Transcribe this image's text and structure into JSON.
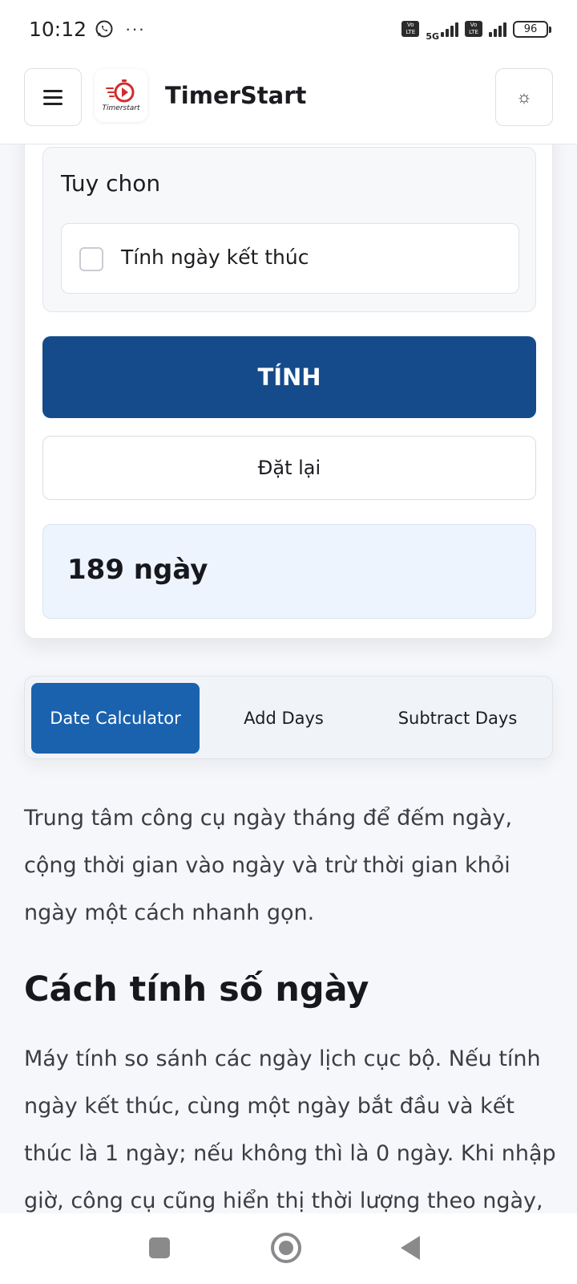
{
  "status_bar": {
    "time": "10:12",
    "more": "···",
    "network": "5G",
    "volte": "Vo LTE",
    "battery": "96"
  },
  "header": {
    "brand": "TimerStart",
    "logo_text": "Timerstart",
    "theme_icon": "☼"
  },
  "calculator": {
    "options_title": "Tuy chon",
    "end_date_option": "Tính ngày kết thúc",
    "end_date_checked": false,
    "calculate_label": "TÍNH",
    "reset_label": "Đặt lại",
    "result": "189 ngày"
  },
  "tabs": [
    {
      "label": "Date Calculator",
      "active": true
    },
    {
      "label": "Add Days",
      "active": false
    },
    {
      "label": "Subtract Days",
      "active": false
    }
  ],
  "article": {
    "intro": "Trung tâm công cụ ngày tháng để đếm ngày, cộng thời gian vào ngày và trừ thời gian khỏi ngày một cách nhanh gọn.",
    "heading": "Cách tính số ngày",
    "body": "Máy tính so sánh các ngày lịch cục bộ. Nếu tính ngày kết thúc, cùng một ngày bắt đầu và kết thúc là 1 ngày; nếu không thì là 0 ngày. Khi nhập giờ, công cụ cũng hiển thị thời lượng theo ngày, giờ, phút và"
  },
  "colors": {
    "primary_button": "#154b8a",
    "active_tab": "#1a62ae",
    "result_bg": "#edf4fd",
    "logo_red": "#d42a2a"
  },
  "icons": {
    "menu": "hamburger-icon",
    "theme": "sun-icon",
    "status": "whatsapp-icon"
  }
}
